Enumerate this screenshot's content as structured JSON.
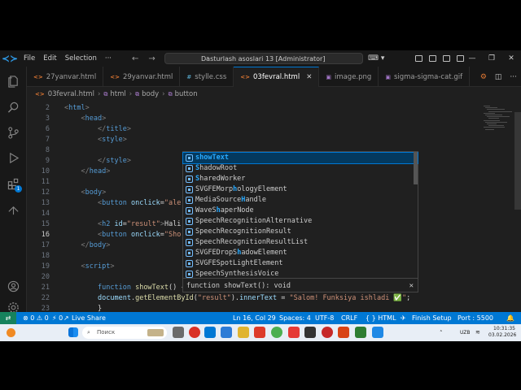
{
  "titlebar": {
    "menu": [
      "File",
      "Edit",
      "Selection",
      "···"
    ],
    "search": "Dasturlash asoslari 13 [Administrator]"
  },
  "tabs": [
    {
      "icon": "<>",
      "label": "27yanvar.html",
      "icon_color": "#e37933"
    },
    {
      "icon": "<>",
      "label": "29yanvar.html",
      "icon_color": "#e37933"
    },
    {
      "icon": "#",
      "label": "stylle.css",
      "icon_color": "#519aba"
    },
    {
      "icon": "<>",
      "label": "03fevral.html",
      "icon_color": "#e37933",
      "active": true
    },
    {
      "icon": "▣",
      "label": "image.png",
      "icon_color": "#a074c4"
    },
    {
      "icon": "▣",
      "label": "sigma-sigma-cat.gif",
      "icon_color": "#a074c4"
    }
  ],
  "breadcrumb": [
    "03fevral.html",
    "html",
    "body",
    "button"
  ],
  "editor": {
    "lines": [
      {
        "n": "2",
        "html": "<span class='punc'>&lt;</span><span class='tag'>html</span><span class='punc'>&gt;</span>",
        "indent": 0
      },
      {
        "n": "3",
        "html": "<span class='punc'>&lt;</span><span class='tag'>head</span><span class='punc'>&gt;</span>",
        "indent": 1
      },
      {
        "n": "6",
        "html": "<span class='punc'>&lt;/</span><span class='tag'>title</span><span class='punc'>&gt;</span>",
        "indent": 2
      },
      {
        "n": "7",
        "html": "<span class='punc'>&lt;</span><span class='tag'>style</span><span class='punc'>&gt;</span>",
        "indent": 2
      },
      {
        "n": "8",
        "html": "",
        "indent": 0
      },
      {
        "n": "9",
        "html": "<span class='punc'>&lt;/</span><span class='tag'>style</span><span class='punc'>&gt;</span>",
        "indent": 2
      },
      {
        "n": "10",
        "html": "<span class='punc'>&lt;/</span><span class='tag'>head</span><span class='punc'>&gt;</span>",
        "indent": 1
      },
      {
        "n": "11",
        "html": "",
        "indent": 0
      },
      {
        "n": "12",
        "html": "<span class='punc'>&lt;</span><span class='tag'>body</span><span class='punc'>&gt;</span>",
        "indent": 1
      },
      {
        "n": "13",
        "html": "<span class='punc'>&lt;</span><span class='tag'>button</span> <span class='attr'>onclick</span><span class='txt'>=</span><span class='str'>\"ale</span>",
        "indent": 2
      },
      {
        "n": "14",
        "html": "",
        "indent": 0
      },
      {
        "n": "15",
        "html": "<span class='punc'>&lt;</span><span class='tag'>h2</span> <span class='attr'>id</span><span class='txt'>=</span><span class='str'>\"result\"</span><span class='punc'>&gt;</span><span class='txt'>Hali</span>",
        "indent": 2
      },
      {
        "n": "16",
        "html": "<span class='punc'>&lt;</span><span class='tag'>button</span> <span class='attr'>onclick</span><span class='txt'>=</span><span class='str'>\"Sho</span>",
        "indent": 2,
        "current": true
      },
      {
        "n": "17",
        "html": "<span class='punc'>&lt;/</span><span class='tag'>body</span><span class='punc'>&gt;</span>",
        "indent": 1
      },
      {
        "n": "18",
        "html": "",
        "indent": 0
      },
      {
        "n": "19",
        "html": "<span class='punc'>&lt;</span><span class='tag'>script</span><span class='punc'>&gt;</span>",
        "indent": 1
      },
      {
        "n": "20",
        "html": "",
        "indent": 0
      },
      {
        "n": "21",
        "html": "<span class='kw'>function</span> <span class='fn'>showText</span><span class='txt'>() {</span>",
        "indent": 2
      },
      {
        "n": "22",
        "html": "<span class='prop'>document</span><span class='txt'>.</span><span class='fn'>getElementById</span><span class='txt'>(</span><span class='str'>\"result\"</span><span class='txt'>).</span><span class='prop'>innerText</span> <span class='txt'>=</span> <span class='str'>\"Salom! Funksiya ishladi ✅\"</span><span class='txt'>;</span>",
        "indent": 2
      },
      {
        "n": "23",
        "html": "<span class='txt'>}</span>",
        "indent": 2
      }
    ]
  },
  "suggest": {
    "items": [
      {
        "pre": "",
        "hl": "showText",
        "post": "",
        "selected": true
      },
      {
        "pre": "",
        "hl": "S",
        "post": "hadowRoot",
        "hl2": ""
      },
      {
        "pre": "",
        "hl": "S",
        "post": "haredWorker"
      },
      {
        "pre": "SVGFEMorp",
        "hl": "h",
        "post": "ologyElement"
      },
      {
        "pre": "MediaSource",
        "hl": "H",
        "post": "andle"
      },
      {
        "pre": "WaveS",
        "hl": "h",
        "post": "aperNode"
      },
      {
        "pre": "SpeechRecognitionAlternative",
        "hl": "",
        "post": ""
      },
      {
        "pre": "SpeechRecognitionResult",
        "hl": "",
        "post": ""
      },
      {
        "pre": "SpeechRecognitionResultList",
        "hl": "",
        "post": ""
      },
      {
        "pre": "SVGFEDropS",
        "hl": "h",
        "post": "adowElement"
      },
      {
        "pre": "SVGFESpotLightElement",
        "hl": "",
        "post": ""
      },
      {
        "pre": "SpeechSynthesisVoice",
        "hl": "",
        "post": ""
      }
    ],
    "detail": "function showText(): void",
    "close": "✕"
  },
  "statusbar": {
    "errors": "⊗ 0 ⚠ 0",
    "ports": "⚡ 0",
    "live_share": "Live Share",
    "position": "Ln 16, Col 29",
    "spaces": "Spaces: 4",
    "encoding": "UTF-8",
    "eol": "CRLF",
    "language": "{ } HTML",
    "finish_setup": "Finish Setup",
    "port": "Port : 5500"
  },
  "taskbar": {
    "search_placeholder": "Поиск",
    "lang": "UZB",
    "time": "10:31:35",
    "date": "03.02.2026"
  }
}
